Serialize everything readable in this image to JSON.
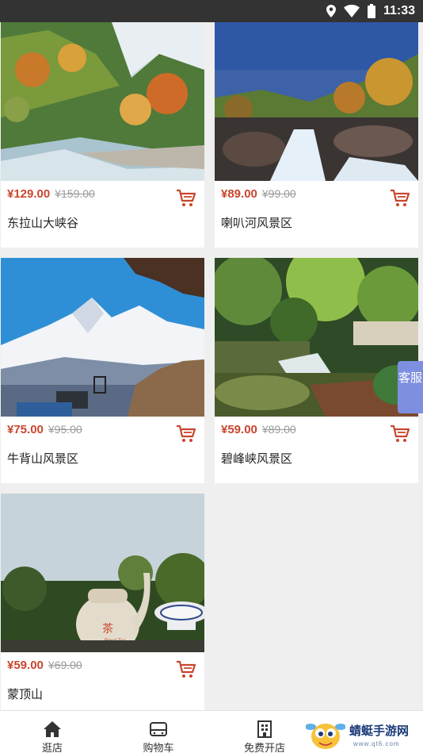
{
  "status_bar": {
    "time": "11:33"
  },
  "currency": "¥",
  "products": [
    {
      "title": "东拉山大峡谷",
      "price": "¥129.00",
      "original_price": "¥159.00"
    },
    {
      "title": "喇叭河风景区",
      "price": "¥89.00",
      "original_price": "¥99.00"
    },
    {
      "title": "牛背山风景区",
      "price": "¥75.00",
      "original_price": "¥95.00"
    },
    {
      "title": "碧峰峡风景区",
      "price": "¥59.00",
      "original_price": "¥89.00"
    },
    {
      "title": "蒙顶山",
      "price": "¥59.00",
      "original_price": "¥69.00"
    }
  ],
  "service_tab": {
    "label": "客服"
  },
  "photo_signs": {
    "tea_pot": "茶",
    "tea_sub": "Royal Tea"
  },
  "bottom_nav": [
    {
      "label": "逛店",
      "icon": "home-icon"
    },
    {
      "label": "购物车",
      "icon": "cart-icon"
    },
    {
      "label": "免费开店",
      "icon": "building-icon"
    }
  ],
  "watermark": {
    "text": "蜻蜓手游网",
    "sub": "www.qt6.com"
  },
  "colors": {
    "price": "#c8462e",
    "cart": "#c8462e",
    "service_tab": "#7f8fe0",
    "status_bar": "#333333"
  }
}
